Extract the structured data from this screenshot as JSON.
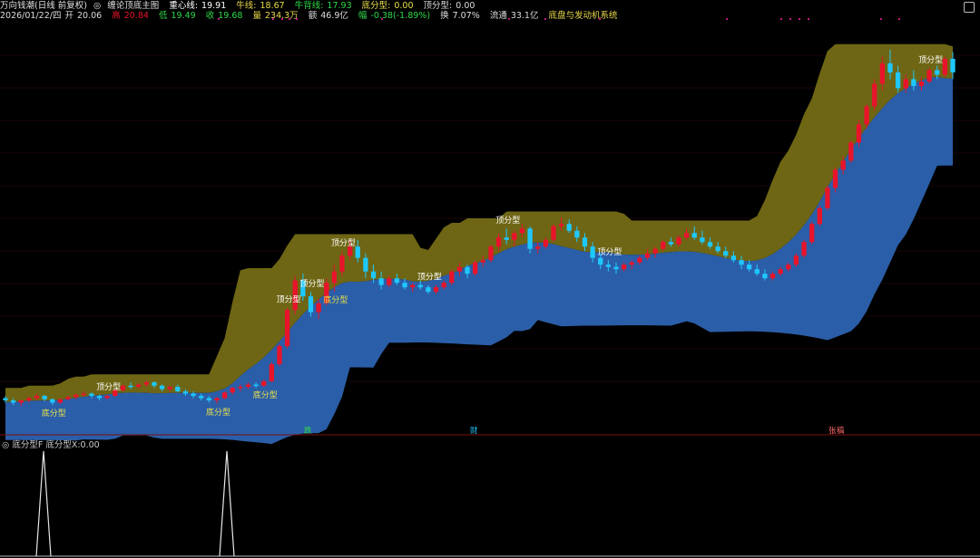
{
  "header": {
    "stock": "万向钱潮(日线 前复权)",
    "indicator": "缠论顶底主图",
    "zxx_label": "重心线:",
    "zxx_val": "19.91",
    "nx_label": "牛线:",
    "nx_val": "18.67",
    "nbx_label": "牛背线:",
    "nbx_val": "17.93",
    "dfx_label": "底分型:",
    "dfx_val": "0.00",
    "tfx_label": "顶分型:",
    "tfx_val": "0.00",
    "date": "2026/01/22/四",
    "open_label": "开",
    "open_val": "20.06",
    "high_label": "高",
    "high_val": "20.84",
    "low_label": "低",
    "low_val": "19.49",
    "close_label": "收",
    "close_val": "19.68",
    "vol_label": "量",
    "vol_val": "234.3万",
    "amt_label": "额",
    "amt_val": "46.9亿",
    "chg_label": "幅",
    "chg_val": "-0.38(-1.89%)",
    "turn_label": "换",
    "turn_val": "7.07%",
    "circ_label": "流通",
    "circ_val": "33.1亿",
    "system": "底盘与发动机系统"
  },
  "labels": {
    "top": "顶分型",
    "bottom": "底分型",
    "marker_1": "跌",
    "marker_2": "财",
    "marker_3": "张",
    "marker_4": "稿"
  },
  "sub": {
    "title": "底分型F",
    "value_label": "底分型X:",
    "value": "0.00"
  },
  "colors": {
    "up": "#e8142a",
    "down": "#1ec8ff",
    "band_upper": "#6e6614",
    "band_lower": "#2b5ea8",
    "label_top": "#ffffff",
    "label_bottom": "#e8e04a",
    "grid": "#3a0a0a"
  },
  "chart_data": {
    "type": "candlestick",
    "candles": [
      [
        10.9,
        11.0,
        10.7,
        10.8
      ],
      [
        10.8,
        10.9,
        10.6,
        10.7
      ],
      [
        10.7,
        10.85,
        10.55,
        10.8
      ],
      [
        10.8,
        10.95,
        10.7,
        10.9
      ],
      [
        10.9,
        11.1,
        10.8,
        11.0
      ],
      [
        11.0,
        11.05,
        10.75,
        10.85
      ],
      [
        10.85,
        10.9,
        10.6,
        10.7
      ],
      [
        10.7,
        10.9,
        10.65,
        10.85
      ],
      [
        10.85,
        11.0,
        10.8,
        10.95
      ],
      [
        10.95,
        11.1,
        10.85,
        11.05
      ],
      [
        11.05,
        11.2,
        10.95,
        11.1
      ],
      [
        11.1,
        11.15,
        10.9,
        11.0
      ],
      [
        11.0,
        11.05,
        10.8,
        10.9
      ],
      [
        10.9,
        11.05,
        10.85,
        11.0
      ],
      [
        11.0,
        11.3,
        10.95,
        11.25
      ],
      [
        11.25,
        11.5,
        11.2,
        11.45
      ],
      [
        11.45,
        11.6,
        11.3,
        11.4
      ],
      [
        11.4,
        11.55,
        11.35,
        11.5
      ],
      [
        11.5,
        11.7,
        11.4,
        11.6
      ],
      [
        11.6,
        11.65,
        11.35,
        11.45
      ],
      [
        11.45,
        11.5,
        11.2,
        11.3
      ],
      [
        11.3,
        11.45,
        11.2,
        11.4
      ],
      [
        11.4,
        11.5,
        11.15,
        11.2
      ],
      [
        11.2,
        11.3,
        11.0,
        11.1
      ],
      [
        11.1,
        11.2,
        10.9,
        11.0
      ],
      [
        11.0,
        11.1,
        10.8,
        10.9
      ],
      [
        10.9,
        11.0,
        10.7,
        10.8
      ],
      [
        10.8,
        10.95,
        10.65,
        10.9
      ],
      [
        10.9,
        11.2,
        10.85,
        11.15
      ],
      [
        11.15,
        11.4,
        11.05,
        11.35
      ],
      [
        11.35,
        11.5,
        11.2,
        11.4
      ],
      [
        11.4,
        11.6,
        11.3,
        11.5
      ],
      [
        11.5,
        11.6,
        11.35,
        11.45
      ],
      [
        11.45,
        11.7,
        11.4,
        11.65
      ],
      [
        11.65,
        12.5,
        11.6,
        12.4
      ],
      [
        12.4,
        13.3,
        12.3,
        13.2
      ],
      [
        13.2,
        14.9,
        13.1,
        14.8
      ],
      [
        14.8,
        16.3,
        14.6,
        16.1
      ],
      [
        16.1,
        16.4,
        15.2,
        15.4
      ],
      [
        15.4,
        15.6,
        14.5,
        14.7
      ],
      [
        14.7,
        15.3,
        14.4,
        15.1
      ],
      [
        15.1,
        16.2,
        15.0,
        16.0
      ],
      [
        16.0,
        16.8,
        15.6,
        16.5
      ],
      [
        16.5,
        17.4,
        16.3,
        17.2
      ],
      [
        17.2,
        17.9,
        17.0,
        17.6
      ],
      [
        17.6,
        17.9,
        16.9,
        17.1
      ],
      [
        17.1,
        17.3,
        16.2,
        16.5
      ],
      [
        16.5,
        16.8,
        16.0,
        16.2
      ],
      [
        16.2,
        16.5,
        15.7,
        15.9
      ],
      [
        15.9,
        16.3,
        15.8,
        16.2
      ],
      [
        16.2,
        16.4,
        15.9,
        16.0
      ],
      [
        16.0,
        16.2,
        15.7,
        15.8
      ],
      [
        15.8,
        16.0,
        15.6,
        15.9
      ],
      [
        15.9,
        16.1,
        15.7,
        15.8
      ],
      [
        15.8,
        15.9,
        15.5,
        15.6
      ],
      [
        15.6,
        15.9,
        15.5,
        15.8
      ],
      [
        15.8,
        16.1,
        15.7,
        16.0
      ],
      [
        16.0,
        16.6,
        15.9,
        16.5
      ],
      [
        16.5,
        16.9,
        16.3,
        16.7
      ],
      [
        16.7,
        16.8,
        16.2,
        16.4
      ],
      [
        16.4,
        17.0,
        16.3,
        16.9
      ],
      [
        16.9,
        17.2,
        16.7,
        17.0
      ],
      [
        17.0,
        17.7,
        16.9,
        17.6
      ],
      [
        17.6,
        18.2,
        17.4,
        18.0
      ],
      [
        18.0,
        18.4,
        17.7,
        17.9
      ],
      [
        17.9,
        18.3,
        17.6,
        18.2
      ],
      [
        18.2,
        18.6,
        18.0,
        18.4
      ],
      [
        18.4,
        18.5,
        17.3,
        17.5
      ],
      [
        17.5,
        17.8,
        17.3,
        17.6
      ],
      [
        17.6,
        18.0,
        17.5,
        17.9
      ],
      [
        17.9,
        18.6,
        17.8,
        18.5
      ],
      [
        18.5,
        18.9,
        18.3,
        18.6
      ],
      [
        18.6,
        18.8,
        18.2,
        18.3
      ],
      [
        18.3,
        18.5,
        17.8,
        18.0
      ],
      [
        18.0,
        18.2,
        17.4,
        17.6
      ],
      [
        17.6,
        17.8,
        16.9,
        17.1
      ],
      [
        17.1,
        17.3,
        16.6,
        16.8
      ],
      [
        16.8,
        17.0,
        16.5,
        16.7
      ],
      [
        16.7,
        16.9,
        16.4,
        16.6
      ],
      [
        16.6,
        16.9,
        16.5,
        16.8
      ],
      [
        16.8,
        17.0,
        16.6,
        16.9
      ],
      [
        16.9,
        17.2,
        16.8,
        17.1
      ],
      [
        17.1,
        17.5,
        17.0,
        17.3
      ],
      [
        17.3,
        17.6,
        17.1,
        17.5
      ],
      [
        17.5,
        17.9,
        17.4,
        17.8
      ],
      [
        17.8,
        18.0,
        17.6,
        17.7
      ],
      [
        17.7,
        18.1,
        17.6,
        18.0
      ],
      [
        18.0,
        18.4,
        17.9,
        18.2
      ],
      [
        18.2,
        18.5,
        17.9,
        18.0
      ],
      [
        18.0,
        18.3,
        17.7,
        17.8
      ],
      [
        17.8,
        18.0,
        17.5,
        17.6
      ],
      [
        17.6,
        17.8,
        17.3,
        17.4
      ],
      [
        17.4,
        17.6,
        17.1,
        17.2
      ],
      [
        17.2,
        17.4,
        16.9,
        17.0
      ],
      [
        17.0,
        17.2,
        16.6,
        16.8
      ],
      [
        16.8,
        17.0,
        16.5,
        16.6
      ],
      [
        16.6,
        16.8,
        16.3,
        16.4
      ],
      [
        16.4,
        16.6,
        16.1,
        16.2
      ],
      [
        16.2,
        16.5,
        16.1,
        16.4
      ],
      [
        16.4,
        16.7,
        16.3,
        16.6
      ],
      [
        16.6,
        16.9,
        16.5,
        16.8
      ],
      [
        16.8,
        17.3,
        16.7,
        17.2
      ],
      [
        17.2,
        17.9,
        17.1,
        17.8
      ],
      [
        17.8,
        18.7,
        17.7,
        18.6
      ],
      [
        18.6,
        19.4,
        18.5,
        19.3
      ],
      [
        19.3,
        20.3,
        19.2,
        20.2
      ],
      [
        20.2,
        21.1,
        20.0,
        21.0
      ],
      [
        21.0,
        21.6,
        20.8,
        21.4
      ],
      [
        21.4,
        22.3,
        21.3,
        22.2
      ],
      [
        22.2,
        23.2,
        22.0,
        23.0
      ],
      [
        23.0,
        23.9,
        22.8,
        23.8
      ],
      [
        23.8,
        25.0,
        23.6,
        24.8
      ],
      [
        24.8,
        26.0,
        24.5,
        25.7
      ],
      [
        25.7,
        26.3,
        25.0,
        25.3
      ],
      [
        25.3,
        25.6,
        24.4,
        24.6
      ],
      [
        24.6,
        25.2,
        24.4,
        25.0
      ],
      [
        25.0,
        25.4,
        24.5,
        24.7
      ],
      [
        24.7,
        25.1,
        24.5,
        24.9
      ],
      [
        24.9,
        25.5,
        24.8,
        25.4
      ],
      [
        25.4,
        25.6,
        25.0,
        25.2
      ],
      [
        25.2,
        26.0,
        25.1,
        25.9
      ],
      [
        25.9,
        26.2,
        25.0,
        25.3
      ]
    ],
    "tops": [
      13,
      36,
      39,
      43,
      54,
      64,
      77,
      118
    ],
    "bottoms": [
      6,
      27,
      33,
      42
    ]
  }
}
